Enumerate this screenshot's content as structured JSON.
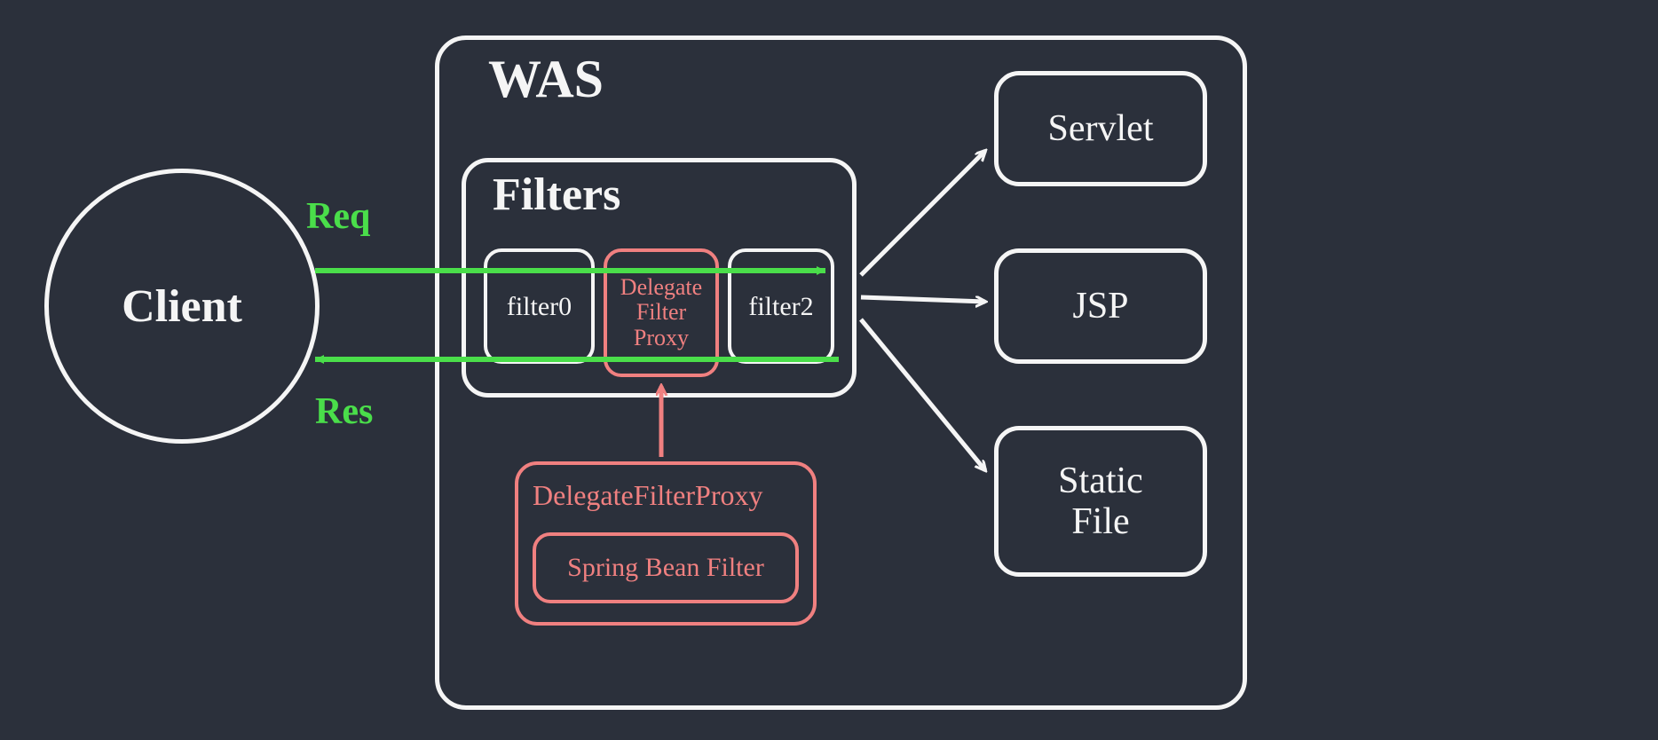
{
  "client": {
    "label": "Client"
  },
  "was": {
    "label": "WAS"
  },
  "filters": {
    "label": "Filters",
    "items": [
      {
        "label": "filter0"
      },
      {
        "label": "Delegate\nFilter\nProxy"
      },
      {
        "label": "filter2"
      }
    ]
  },
  "delegateFilterProxy": {
    "title": "DelegateFilterProxy",
    "inner": "Spring Bean Filter"
  },
  "targets": [
    {
      "label": "Servlet"
    },
    {
      "label": "JSP"
    },
    {
      "label": "Static\nFile"
    }
  ],
  "labels": {
    "req": "Req",
    "res": "Res"
  }
}
